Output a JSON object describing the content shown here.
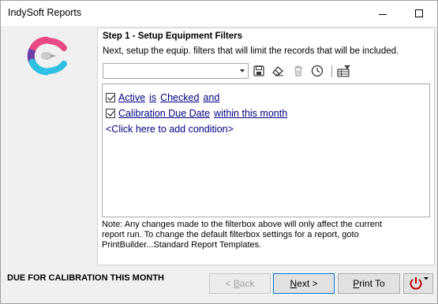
{
  "window": {
    "title": "IndySoft Reports"
  },
  "step": {
    "title": "Step 1 - Setup Equipment Filters",
    "subtitle": "Next, setup the equip. filters that will limit the records that will be included."
  },
  "filter_combo": {
    "value": ""
  },
  "toolbar": {
    "icons": [
      "save-icon",
      "eraser-icon",
      "trash-icon",
      "history-icon",
      "grid-filter-icon"
    ]
  },
  "conditions": [
    {
      "checked": true,
      "field": "Active",
      "operator": "is",
      "value": "Checked",
      "join": "and"
    },
    {
      "checked": true,
      "field": "Calibration Due Date",
      "operator": "within this month"
    }
  ],
  "add_condition": "<Click here to add condition>",
  "note": {
    "line1": "Note:  Any changes made to the filterbox above will only affect the current",
    "line2": "report run.  To change the default filterbox settings for a report, goto",
    "line3": "PrintBuilder...Standard Report Templates."
  },
  "status": {
    "report_name": "DUE FOR CALIBRATION THIS MONTH"
  },
  "buttons": {
    "back_arrow": "< ",
    "back_ul": "B",
    "back_rest": "ack",
    "next_ul": "N",
    "next_rest": "ext >",
    "print_ul": "P",
    "print_rest": "rint To"
  },
  "colors": {
    "accent": "#0078d7",
    "link": "#000080",
    "power": "#c00000"
  }
}
